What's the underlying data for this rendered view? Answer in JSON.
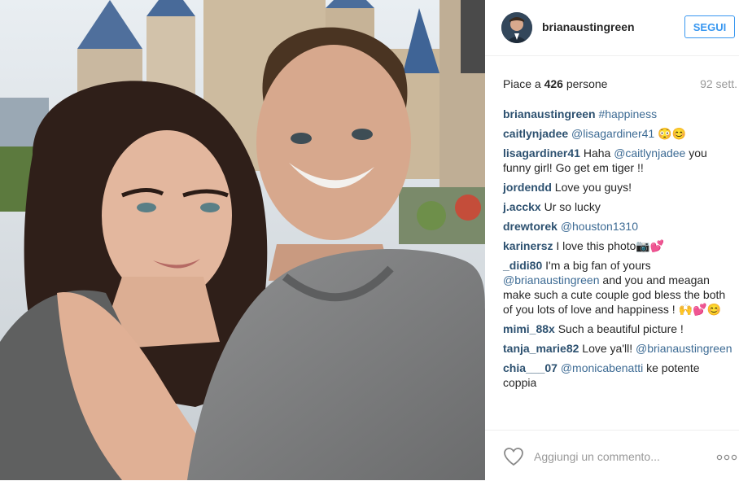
{
  "post": {
    "username": "brianaustingreen",
    "follow_label": "SEGUI",
    "likes_prefix": "Piace a ",
    "likes_count": "426",
    "likes_suffix": " persone",
    "time": "92 sett."
  },
  "comments": [
    {
      "user": "brianaustingreen",
      "text": "#happiness",
      "text_is_tag": true
    },
    {
      "user": "caitlynjadee",
      "mention": "@lisagardiner41",
      "text": " 😳😊"
    },
    {
      "user": "lisagardiner41",
      "text": " Haha ",
      "mention": "@caitlynjadee",
      "text2": " you funny girl! Go get em tiger !!"
    },
    {
      "user": "jordendd",
      "text": " Love you guys!"
    },
    {
      "user": "j.acckx",
      "text": " Ur so lucky"
    },
    {
      "user": "drewtorek",
      "mention": "@houston1310",
      "text": ""
    },
    {
      "user": "karinersz",
      "text": " I love this photo📷💕"
    },
    {
      "user": "_didi80",
      "text": " I'm a big fan of yours ",
      "mention": "@brianaustingreen",
      "text2": " and you and meagan make such a cute couple god bless the both of you lots of love and happiness ! 🙌💕😊"
    },
    {
      "user": "mimi_88x",
      "text": " Such a beautiful picture !"
    },
    {
      "user": "tanja_marie82",
      "text": " Love ya'll! ",
      "mention": "@brianaustingreen",
      "text2": ""
    },
    {
      "user": "chia___07",
      "mention": "@monicabenatti",
      "text": " ke potente coppia"
    }
  ],
  "footer": {
    "add_comment_placeholder": "Aggiungi un commento..."
  },
  "icons": {
    "like": "heart-icon",
    "more": "more-options-icon"
  },
  "colors": {
    "accent": "#3897f0",
    "username": "#2d5170",
    "mention": "#3d6b94",
    "muted": "#999999"
  }
}
